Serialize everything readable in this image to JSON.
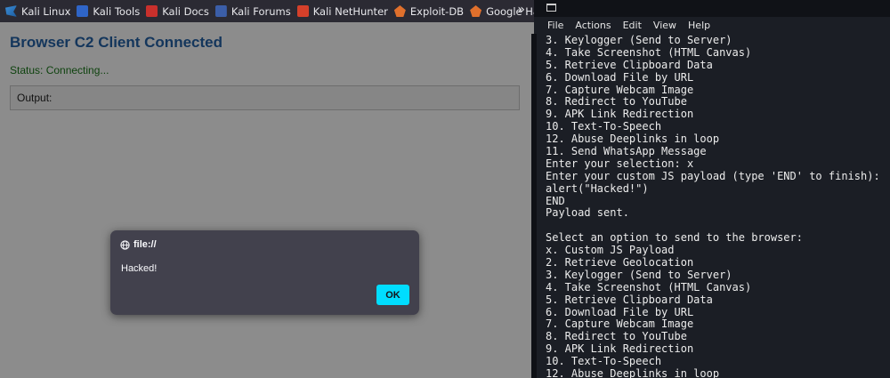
{
  "bookmarks": {
    "items": [
      {
        "label": "Kali Linux",
        "icon": "kali-dragon-icon"
      },
      {
        "label": "Kali Tools",
        "icon": "kali-tools-icon"
      },
      {
        "label": "Kali Docs",
        "icon": "kali-docs-icon"
      },
      {
        "label": "Kali Forums",
        "icon": "kali-forums-icon"
      },
      {
        "label": "Kali NetHunter",
        "icon": "kali-nethunter-icon"
      },
      {
        "label": "Exploit-DB",
        "icon": "exploit-db-icon"
      },
      {
        "label": "Google Hacking DB",
        "icon": "ghdb-icon"
      }
    ],
    "more": "»"
  },
  "page": {
    "title": "Browser C2 Client Connected",
    "status": "Status: Connecting...",
    "output_label": "Output:"
  },
  "dialog": {
    "origin": "file://",
    "message": "Hacked!",
    "ok_label": "OK"
  },
  "terminal": {
    "menu": [
      "File",
      "Actions",
      "Edit",
      "View",
      "Help"
    ],
    "lines": [
      "3. Keylogger (Send to Server)",
      "4. Take Screenshot (HTML Canvas)",
      "5. Retrieve Clipboard Data",
      "6. Download File by URL",
      "7. Capture Webcam Image",
      "8. Redirect to YouTube",
      "9. APK Link Redirection",
      "10. Text-To-Speech",
      "12. Abuse Deeplinks in loop",
      "11. Send WhatsApp Message",
      "Enter your selection: x",
      "Enter your custom JS payload (type 'END' to finish):",
      "alert(\"Hacked!\")",
      "END",
      "Payload sent.",
      "",
      "Select an option to send to the browser:",
      "x. Custom JS Payload",
      "2. Retrieve Geolocation",
      "3. Keylogger (Send to Server)",
      "4. Take Screenshot (HTML Canvas)",
      "5. Retrieve Clipboard Data",
      "6. Download File by URL",
      "7. Capture Webcam Image",
      "8. Redirect to YouTube",
      "9. APK Link Redirection",
      "10. Text-To-Speech",
      "12. Abuse Deeplinks in loop"
    ]
  },
  "colors": {
    "title_blue": "#2563a8",
    "status_green": "#1d7a1d",
    "ok_button": "#00ddff",
    "dialog_bg": "#42414d",
    "terminal_bg": "#1b1e25"
  }
}
